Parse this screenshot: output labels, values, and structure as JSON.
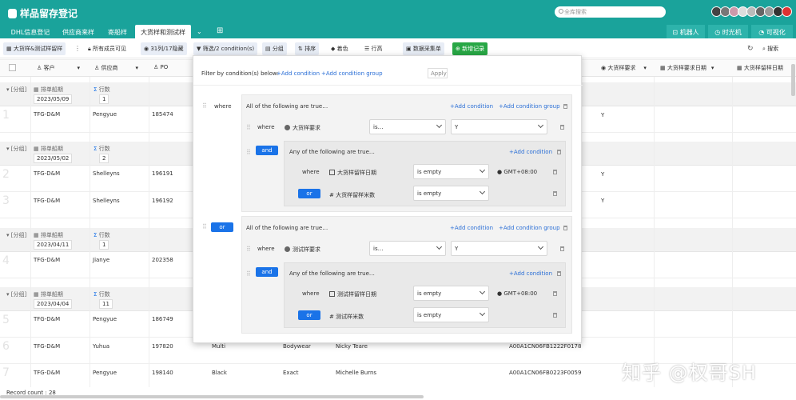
{
  "app": {
    "title": "样品留存登记",
    "search_placeholder": "全库搜索"
  },
  "tabs": [
    "DHL信息登记",
    "供应商来样",
    "寄船样",
    "大货样和测试样"
  ],
  "right_tabs": [
    "机器人",
    "时光机",
    "可视化"
  ],
  "toolbar": {
    "view": "大货样&测试样留样",
    "members": "所有成员可见",
    "hidden": "31列/17隐藏",
    "filter": "筛选/2 condition(s)",
    "group": "分组",
    "sort": "排序",
    "color": "着色",
    "row_height": "行高",
    "collect": "数据采集单",
    "new_record": "新增记录",
    "search": "搜索"
  },
  "columns": {
    "customer": "客户",
    "supplier": "供应商",
    "po": "PO",
    "bulk_req": "大货样要求",
    "bulk_req_date": "大货样要求日期",
    "bulk_keep_date": "大货样留样日期"
  },
  "group_label": "[分组]",
  "group_field": "排单船期",
  "count_label": "行数",
  "groups": [
    {
      "date": "2023/05/09",
      "count": "1",
      "rows": [
        {
          "n": "1",
          "customer": "TFG-D&M",
          "supplier": "Pengyue",
          "po": "185474",
          "req": "Y"
        }
      ]
    },
    {
      "date": "2023/05/02",
      "count": "2",
      "rows": [
        {
          "n": "2",
          "customer": "TFG-D&M",
          "supplier": "Shelleyns",
          "po": "196191",
          "req": "Y"
        },
        {
          "n": "3",
          "customer": "TFG-D&M",
          "supplier": "Shelleyns",
          "po": "196192",
          "req": "Y"
        }
      ]
    },
    {
      "date": "2023/04/11",
      "count": "1",
      "rows": [
        {
          "n": "4",
          "customer": "TFG-D&M",
          "supplier": "Jianye",
          "po": "202358"
        }
      ]
    },
    {
      "date": "2023/04/04",
      "count": "11",
      "rows": [
        {
          "n": "5",
          "customer": "TFG-D&M",
          "supplier": "Pengyue",
          "po": "186749"
        },
        {
          "n": "6",
          "customer": "TFG-D&M",
          "supplier": "Yuhua",
          "po": "197820",
          "c4": "Multi",
          "c5": "Bodywear",
          "c6": "Nicky Teare",
          "c7": "A00A1CN06FB1222F0178"
        },
        {
          "n": "7",
          "customer": "TFG-D&M",
          "supplier": "Pengyue",
          "po": "198140",
          "c4": "Black",
          "c5": "Exact",
          "c6": "Michelle Burns",
          "c7": "A00A1CN06FB0223F0059"
        }
      ]
    }
  ],
  "footer": "Record count : 28",
  "filter": {
    "header": "Filter by condition(s) below:",
    "add_condition": "+Add condition",
    "add_group": "+Add condition group",
    "apply": "Apply",
    "where": "where",
    "all_true": "All of the following are true…",
    "any_true": "Any of the following are true…",
    "and": "and",
    "or": "or",
    "is": "is…",
    "is_empty": "is empty",
    "y": "Y",
    "tz": "GMT+08:00",
    "g1": {
      "field": "大货样要求",
      "f2": "大货样留样日期",
      "f3": "大货样留样米数"
    },
    "g2": {
      "field": "测试样要求",
      "f2": "测试样留样日期",
      "f3": "测试样米数"
    }
  },
  "watermark": "知乎 @权哥SH"
}
